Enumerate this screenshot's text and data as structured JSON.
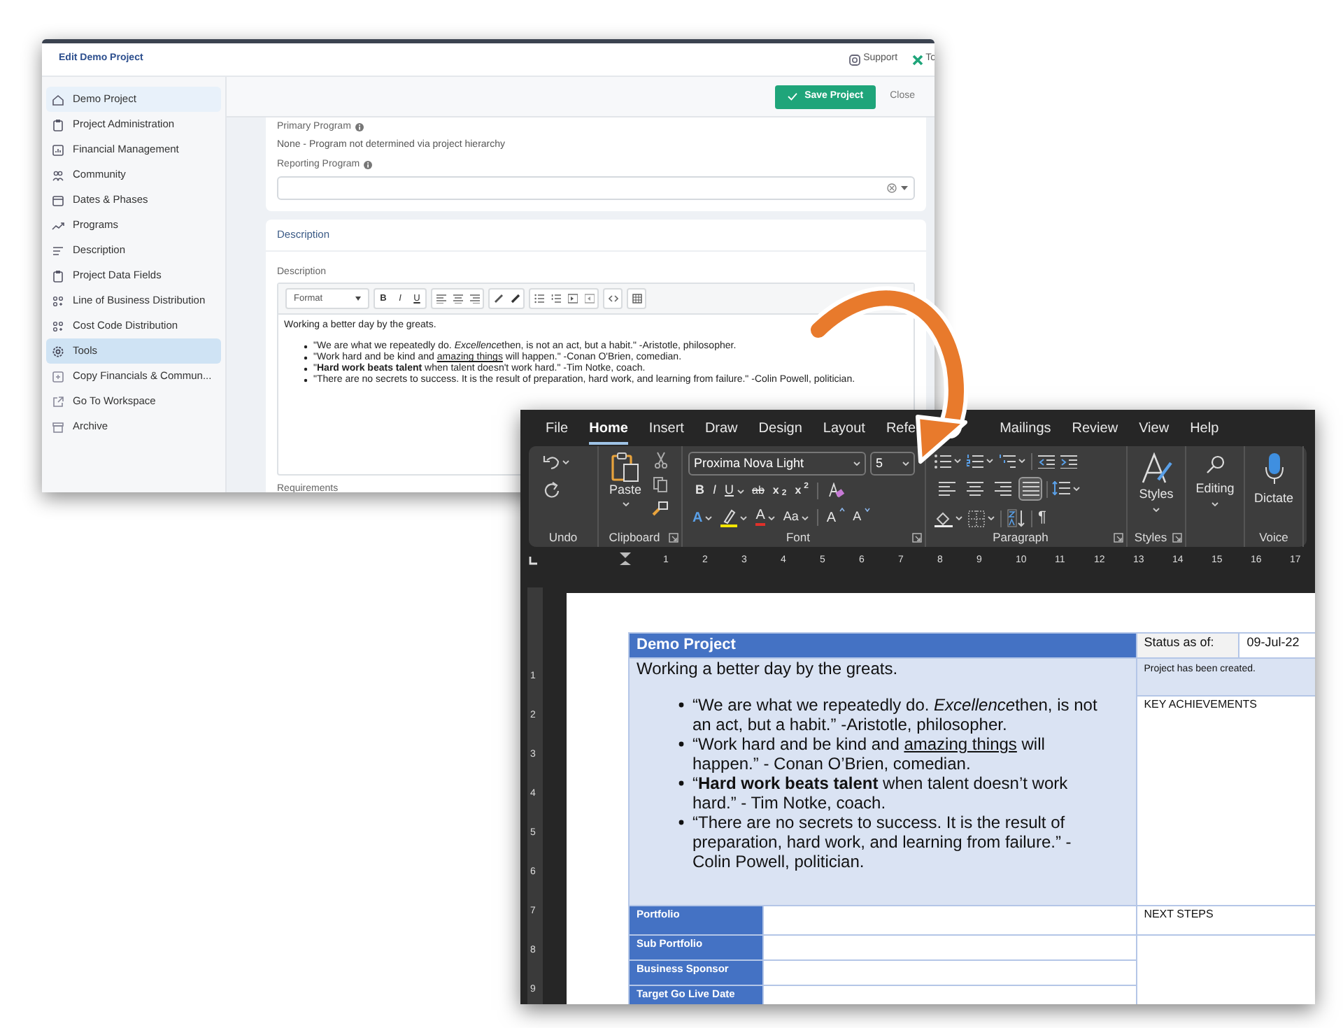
{
  "web_app": {
    "title": "Edit Demo Project",
    "header_links": [
      {
        "label": "Support"
      },
      {
        "label": "To"
      }
    ],
    "sidebar": {
      "items": [
        {
          "label": "Demo Project",
          "current": true,
          "selected": false
        },
        {
          "label": "Project Administration",
          "current": false,
          "selected": false
        },
        {
          "label": "Financial Management",
          "current": false,
          "selected": false
        },
        {
          "label": "Community",
          "current": false,
          "selected": false
        },
        {
          "label": "Dates & Phases",
          "current": false,
          "selected": false
        },
        {
          "label": "Programs",
          "current": false,
          "selected": false
        },
        {
          "label": "Description",
          "current": false,
          "selected": false
        },
        {
          "label": "Project Data Fields",
          "current": false,
          "selected": false
        },
        {
          "label": "Line of Business Distribution",
          "current": false,
          "selected": false
        },
        {
          "label": "Cost Code Distribution",
          "current": false,
          "selected": false
        },
        {
          "label": "Tools",
          "current": false,
          "selected": true
        },
        {
          "label": "Copy Financials & Commun...",
          "current": false,
          "selected": false
        },
        {
          "label": "Go To Workspace",
          "current": false,
          "selected": false
        },
        {
          "label": "Archive",
          "current": false,
          "selected": false
        }
      ]
    },
    "actions": {
      "save": "Save Project",
      "close": "Close"
    },
    "primary_program": {
      "label": "Primary Program",
      "value": "None - Program not determined via project hierarchy"
    },
    "reporting_program": {
      "label": "Reporting Program"
    },
    "description_card": {
      "title": "Description",
      "field_label": "Description",
      "format_select": "Format",
      "toolbar_buttons": [
        {
          "kind": "bold",
          "label": "B"
        },
        {
          "kind": "italic",
          "label": "I"
        },
        {
          "kind": "underline",
          "label": "U"
        }
      ],
      "intro": "Working a better day by the greats.",
      "bullets": [
        [
          {
            "text": "\"We are what we repeatedly do. ",
            "kind": "plain"
          },
          {
            "text": "Excellence",
            "kind": "italic"
          },
          {
            "text": "then, is not an act, but a habit.\" -Aristotle, philosopher.",
            "kind": "plain"
          }
        ],
        [
          {
            "text": "\"Work hard and be kind and ",
            "kind": "plain"
          },
          {
            "text": "amazing things",
            "kind": "underline"
          },
          {
            "text": " will happen.\" -Conan O'Brien, comedian.",
            "kind": "plain"
          }
        ],
        [
          {
            "text": "\"",
            "kind": "plain"
          },
          {
            "text": "Hard work beats talent",
            "kind": "bold"
          },
          {
            "text": " when talent doesn't work hard.\" -Tim Notke, coach.",
            "kind": "plain"
          }
        ],
        [
          {
            "text": "\"There are no secrets to success. It is the result of preparation, hard work, and learning from failure.\" -Colin Powell, politician.",
            "kind": "plain"
          }
        ]
      ]
    },
    "next_field_label": "Requirements"
  },
  "word": {
    "tabs": [
      {
        "label": "File",
        "selected": false
      },
      {
        "label": "Home",
        "selected": true
      },
      {
        "label": "Insert",
        "selected": false
      },
      {
        "label": "Draw",
        "selected": false
      },
      {
        "label": "Design",
        "selected": false
      },
      {
        "label": "Layout",
        "selected": false
      },
      {
        "label": "Refe",
        "selected": false
      },
      {
        "label": "Mailings",
        "selected": false
      },
      {
        "label": "Review",
        "selected": false
      },
      {
        "label": "View",
        "selected": false
      },
      {
        "label": "Help",
        "selected": false
      }
    ],
    "ribbon": {
      "groups": [
        {
          "label": "Undo"
        },
        {
          "label": "Clipboard"
        },
        {
          "label": "Font"
        },
        {
          "label": "Paragraph"
        },
        {
          "label": "Styles"
        }
      ],
      "paste": "Paste",
      "font_name": "Proxima Nova Light",
      "font_size": "5",
      "font_buttons": [
        {
          "kind": "bold",
          "label": "B"
        },
        {
          "kind": "italic",
          "label": "I"
        },
        {
          "kind": "underline",
          "label": "U"
        },
        {
          "kind": "strikethrough",
          "label": "ab"
        },
        {
          "kind": "subscript",
          "label": "x$_{2}$"
        },
        {
          "kind": "superscript",
          "label": "x$^{2}$"
        }
      ],
      "font_buttons_2": [
        {
          "kind": "text_effects",
          "label": "A"
        },
        {
          "kind": "highlight"
        },
        {
          "kind": "font_color",
          "label": "A"
        },
        {
          "kind": "change_case",
          "label": "Aa"
        },
        {
          "kind": "grow",
          "label": "A"
        },
        {
          "kind": "shrink",
          "label": "A"
        }
      ],
      "alignments": [
        {
          "kind": "left",
          "selected": false
        },
        {
          "kind": "center",
          "selected": false
        },
        {
          "kind": "right",
          "selected": false
        },
        {
          "kind": "justify",
          "selected": true
        }
      ],
      "pilcrow": "¶",
      "styles": "Styles",
      "editing": "Editing",
      "dictate": "Dictate",
      "voice": "Voice"
    },
    "ruler": {
      "horizontal": [
        "1",
        "2",
        "3",
        "4",
        "5",
        "6",
        "7",
        "8",
        "9",
        "10",
        "11",
        "12",
        "13",
        "14",
        "15",
        "16",
        "17"
      ],
      "vertical": [
        "1",
        "2",
        "3",
        "4",
        "5",
        "6",
        "7",
        "8",
        "9"
      ]
    },
    "document_table": {
      "title": "Demo Project",
      "intro": "Working a better day by the greats.",
      "bullets": [
        [
          {
            "text": "“We are what we repeatedly do. ",
            "kind": "plain"
          },
          {
            "text": "Excellence",
            "kind": "italic"
          },
          {
            "text": "then, is not an act, but a habit.” -Aristotle, philosopher.",
            "kind": "plain"
          }
        ],
        [
          {
            "text": "“Work hard and be kind and ",
            "kind": "plain"
          },
          {
            "text": "amazing things",
            "kind": "underline"
          },
          {
            "text": " will happen.” - Conan O’Brien, comedian.",
            "kind": "plain"
          }
        ],
        [
          {
            "text": "“",
            "kind": "plain"
          },
          {
            "text": "Hard work beats talent",
            "kind": "bold"
          },
          {
            "text": " when talent doesn’t work hard.” - Tim Notke, coach.",
            "kind": "plain"
          }
        ],
        [
          {
            "text": "“There are no secrets to success. It is the result of preparation, hard work, and learning from failure.” -Colin Powell, politician.",
            "kind": "plain"
          }
        ]
      ],
      "fields": [
        {
          "label": "Portfolio"
        },
        {
          "label": "Sub Portfolio"
        },
        {
          "label": "Business Sponsor"
        },
        {
          "label": "Target Go Live Date"
        }
      ],
      "status_label": "Status as of:",
      "status_date": "09-Jul-22",
      "status_text": "Project has been created.",
      "key_achievements": "KEY ACHIEVEMENTS",
      "next_steps": "NEXT STEPS"
    }
  }
}
